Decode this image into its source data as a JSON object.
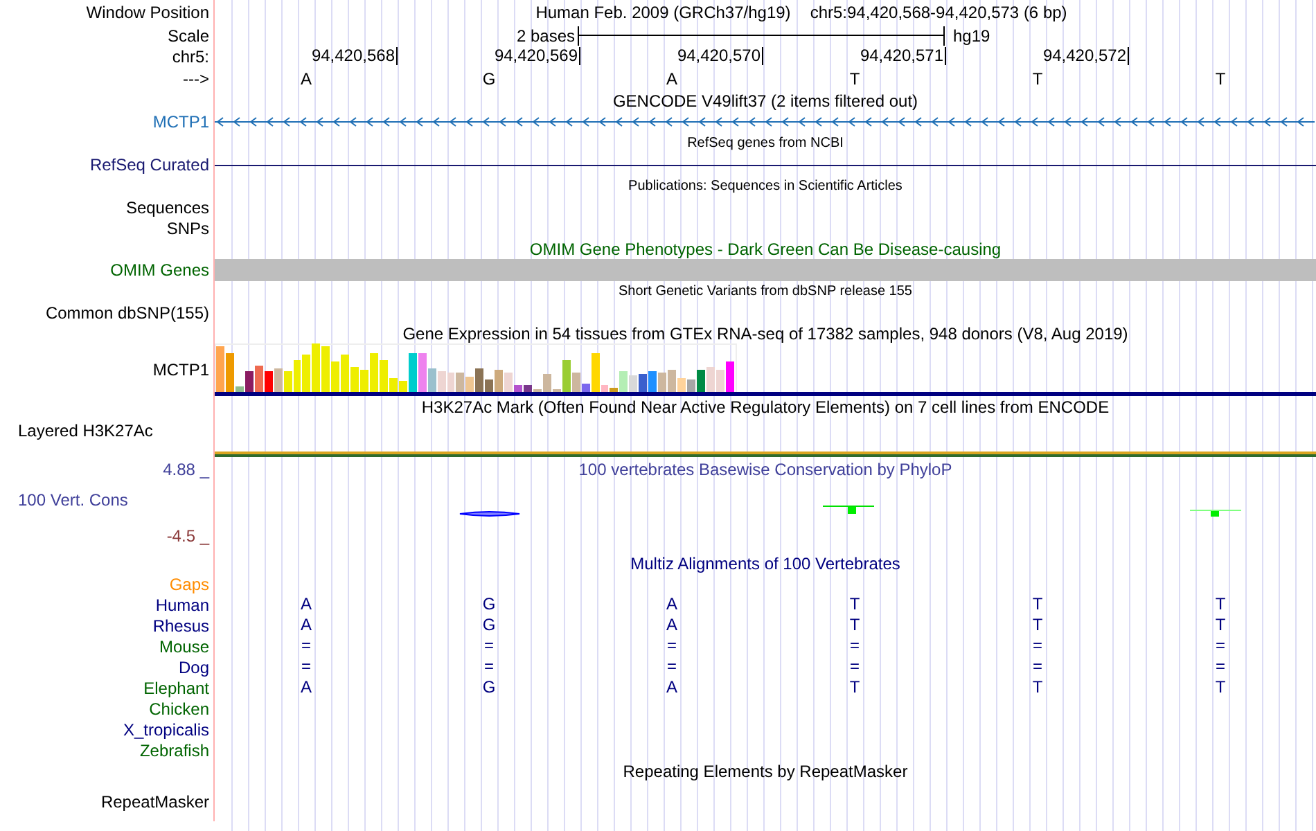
{
  "header": {
    "window_position_label": "Window Position",
    "assembly": "Human Feb. 2009 (GRCh37/hg19)",
    "position": "chr5:94,420,568-94,420,573 (6 bp)",
    "scale_label": "Scale",
    "scale_text": "2 bases",
    "scale_assembly": "hg19",
    "chrom_label": "chr5:",
    "ticks": [
      "94,420,568",
      "94,420,569",
      "94,420,570",
      "94,420,571",
      "94,420,572"
    ],
    "strand_label": "--->",
    "bases": [
      "A",
      "G",
      "A",
      "T",
      "T",
      "T"
    ]
  },
  "rows": [
    {
      "kind": "title",
      "text": "GENCODE V49lift37 (2 items filtered out)",
      "color": "#000000"
    },
    {
      "kind": "gene-arrows",
      "label": "MCTP1",
      "color": "#1f6fb5"
    },
    {
      "kind": "note",
      "text": "RefSeq genes from NCBI"
    },
    {
      "kind": "gene-line",
      "label": "RefSeq Curated",
      "color": "#191970"
    },
    {
      "kind": "note",
      "text": "Publications: Sequences in Scientific Articles"
    },
    {
      "kind": "empty",
      "label": "Sequences",
      "color": "#000000"
    },
    {
      "kind": "empty",
      "label": "SNPs",
      "color": "#000000"
    },
    {
      "kind": "title",
      "text": "OMIM Gene Phenotypes - Dark Green Can Be Disease-causing",
      "color": "#006400"
    },
    {
      "kind": "bar",
      "label": "OMIM Genes",
      "color": "#006400"
    },
    {
      "kind": "note",
      "text": "Short Genetic Variants from dbSNP release 155"
    },
    {
      "kind": "empty",
      "label": "Common dbSNP(155)",
      "color": "#000000"
    },
    {
      "kind": "title",
      "text": "Gene Expression in 54 tissues from GTEx RNA-seq of 17382 samples, 948 donors (V8, Aug 2019)",
      "color": "#000000"
    },
    {
      "kind": "expression",
      "label": "MCTP1",
      "color": "#000000"
    },
    {
      "kind": "title",
      "text": "H3K27Ac Mark (Often Found Near Active Regulatory Elements) on 7 cell lines from ENCODE",
      "color": "#000000"
    },
    {
      "kind": "layered",
      "label": "Layered H3K27Ac",
      "color": "#000000"
    },
    {
      "kind": "conservation",
      "title": "100 vertebrates Basewise Conservation by PhyloP",
      "label": "100 Vert. Cons",
      "max": "4.88 _",
      "min": "-4.5 _",
      "color": "#40409a"
    },
    {
      "kind": "title",
      "text": "Multiz Alignments of 100 Vertebrates",
      "color": "#000080"
    },
    {
      "kind": "species",
      "label": "Gaps",
      "color": "#ff8c00",
      "bases": []
    },
    {
      "kind": "species",
      "label": "Human",
      "color": "#000080",
      "bases": [
        "A",
        "G",
        "A",
        "T",
        "T",
        "T"
      ]
    },
    {
      "kind": "species",
      "label": "Rhesus",
      "color": "#000080",
      "bases": [
        "A",
        "G",
        "A",
        "T",
        "T",
        "T"
      ]
    },
    {
      "kind": "species",
      "label": "Mouse",
      "color": "#006400",
      "bases": [
        "=",
        "=",
        "=",
        "=",
        "=",
        "="
      ]
    },
    {
      "kind": "species",
      "label": "Dog",
      "color": "#000080",
      "bases": [
        "=",
        "=",
        "=",
        "=",
        "=",
        "="
      ]
    },
    {
      "kind": "species",
      "label": "Elephant",
      "color": "#006400",
      "bases": [
        "A",
        "G",
        "A",
        "T",
        "T",
        "T"
      ]
    },
    {
      "kind": "species",
      "label": "Chicken",
      "color": "#006400",
      "bases": []
    },
    {
      "kind": "species",
      "label": "X_tropicalis",
      "color": "#000080",
      "bases": []
    },
    {
      "kind": "species",
      "label": "Zebrafish",
      "color": "#006400",
      "bases": []
    },
    {
      "kind": "title",
      "text": "Repeating Elements by RepeatMasker",
      "color": "#000000"
    },
    {
      "kind": "last",
      "label": "RepeatMasker",
      "color": "#000000"
    }
  ]
}
